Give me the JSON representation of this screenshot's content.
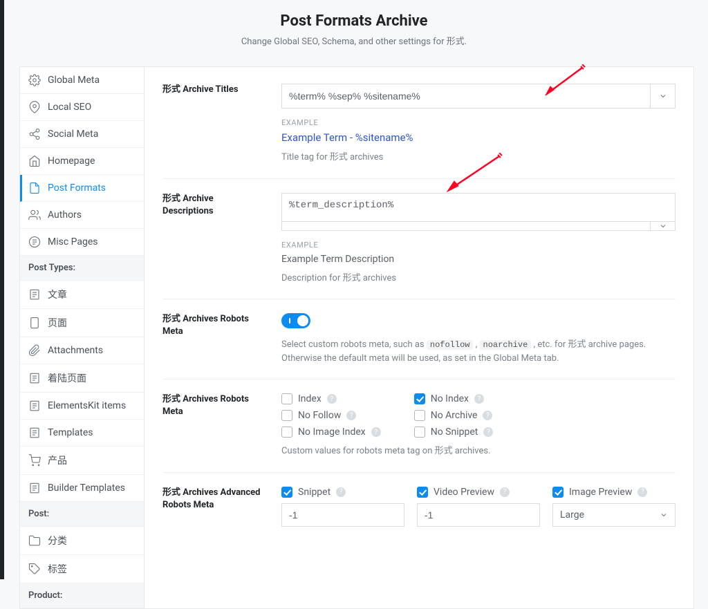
{
  "header": {
    "title": "Post Formats Archive",
    "subtitle": "Change Global SEO, Schema, and other settings for 形式."
  },
  "sidebar": {
    "top_items": [
      {
        "label": "Global Meta",
        "icon": "gear"
      },
      {
        "label": "Local SEO",
        "icon": "pin"
      },
      {
        "label": "Social Meta",
        "icon": "share"
      },
      {
        "label": "Homepage",
        "icon": "home"
      },
      {
        "label": "Post Formats",
        "icon": "page",
        "active": true
      },
      {
        "label": "Authors",
        "icon": "users"
      },
      {
        "label": "Misc Pages",
        "icon": "misc"
      }
    ],
    "heading_post_types": "Post Types:",
    "post_types": [
      {
        "label": "文章"
      },
      {
        "label": "页面"
      },
      {
        "label": "Attachments"
      },
      {
        "label": "着陆页面"
      },
      {
        "label": "ElementsKit items"
      },
      {
        "label": "Templates"
      },
      {
        "label": "产品"
      },
      {
        "label": "Builder Templates"
      }
    ],
    "heading_post": "Post:",
    "post_items": [
      {
        "label": "分类"
      },
      {
        "label": "标签"
      }
    ],
    "heading_product": "Product:"
  },
  "titles": {
    "label": "形式 Archive Titles",
    "value": "%term% %sep% %sitename%",
    "example_caption": "EXAMPLE",
    "example_text": "Example Term - %sitename%",
    "help": "Title tag for 形式 archives"
  },
  "descriptions": {
    "label": "形式 Archive Descriptions",
    "value": "%term_description%",
    "example_caption": "EXAMPLE",
    "example_text": "Example Term Description",
    "help": "Description for 形式 archives"
  },
  "robots_toggle": {
    "label": "形式 Archives Robots Meta",
    "help_prefix": "Select custom robots meta, such as ",
    "chip1": "nofollow",
    "chip_sep": " , ",
    "chip2": "noarchive",
    "help_suffix": " , etc. for 形式 archive pages. Otherwise the default meta will be used, as set in the Global Meta tab."
  },
  "robots_meta": {
    "label": "形式 Archives Robots Meta",
    "left": [
      {
        "label": "Index",
        "checked": false
      },
      {
        "label": "No Follow",
        "checked": false
      },
      {
        "label": "No Image Index",
        "checked": false
      }
    ],
    "right": [
      {
        "label": "No Index",
        "checked": true
      },
      {
        "label": "No Archive",
        "checked": false
      },
      {
        "label": "No Snippet",
        "checked": false
      }
    ],
    "help": "Custom values for robots meta tag on 形式 archives."
  },
  "advanced": {
    "label": "形式 Archives Advanced Robots Meta",
    "items": [
      {
        "label": "Snippet",
        "checked": true,
        "value": "-1",
        "type": "text"
      },
      {
        "label": "Video Preview",
        "checked": true,
        "value": "-1",
        "type": "text"
      },
      {
        "label": "Image Preview",
        "checked": true,
        "value": "Large",
        "type": "select"
      }
    ]
  }
}
